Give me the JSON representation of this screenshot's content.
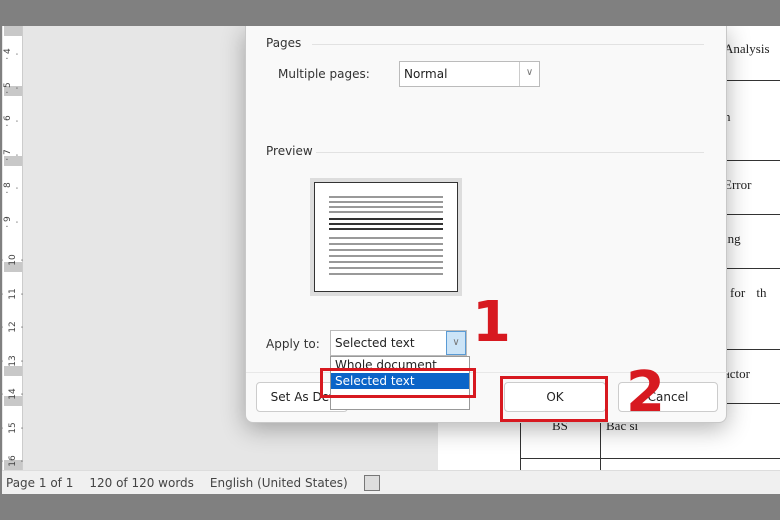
{
  "ruler": {
    "labels": [
      "4",
      "5",
      "6",
      "7",
      "8",
      "9",
      "10",
      "11",
      "12",
      "13",
      "14",
      "15",
      "16"
    ]
  },
  "document": {
    "cells": [
      "Analysis",
      "n",
      "Error",
      "ing",
      "for th",
      "actor",
      "BS",
      "Bac si"
    ]
  },
  "dialog": {
    "pages_section": "Pages",
    "multiple_pages_label": "Multiple pages:",
    "multiple_pages_value": "Normal",
    "preview_section": "Preview",
    "apply_to_label": "Apply to:",
    "apply_to_value": "Selected text",
    "apply_to_options": [
      "Whole document",
      "Selected text"
    ],
    "set_default_label": "Set As Def",
    "ok_label": "OK",
    "cancel_label": "Cancel"
  },
  "annotations": {
    "step1": "1",
    "step2": "2",
    "color": "#d71920"
  },
  "status_bar": {
    "page": "Page 1 of 1",
    "words": "120 of 120 words",
    "language": "English (United States)"
  }
}
